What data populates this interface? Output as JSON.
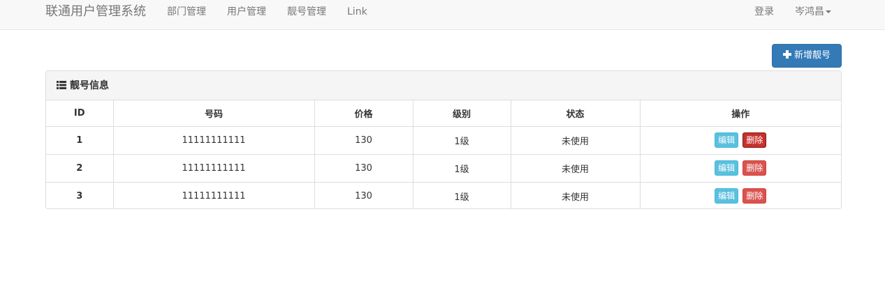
{
  "navbar": {
    "brand": "联通用户管理系统",
    "links": [
      "部门管理",
      "用户管理",
      "靓号管理",
      "Link"
    ],
    "login": "登录",
    "user": "岑鸿昌"
  },
  "actions": {
    "add_label": "新增靓号"
  },
  "panel": {
    "title": "靓号信息"
  },
  "table": {
    "headers": [
      "ID",
      "号码",
      "价格",
      "级别",
      "状态",
      "操作"
    ],
    "rows": [
      {
        "id": "1",
        "mobile": "11111111111",
        "price": "130",
        "level": "1级",
        "status": "未使用",
        "edit": "编辑",
        "delete": "删除"
      },
      {
        "id": "2",
        "mobile": "11111111111",
        "price": "130",
        "level": "1级",
        "status": "未使用",
        "edit": "编辑",
        "delete": "删除"
      },
      {
        "id": "3",
        "mobile": "11111111111",
        "price": "130",
        "level": "1级",
        "status": "未使用",
        "edit": "编辑",
        "delete": "删除"
      }
    ]
  },
  "icons": {
    "add": "plus-icon",
    "panel": "list-icon",
    "user_menu": "caret-down-icon"
  },
  "colors": {
    "primary": "#337ab7",
    "info": "#5bc0de",
    "danger": "#d9534f"
  }
}
